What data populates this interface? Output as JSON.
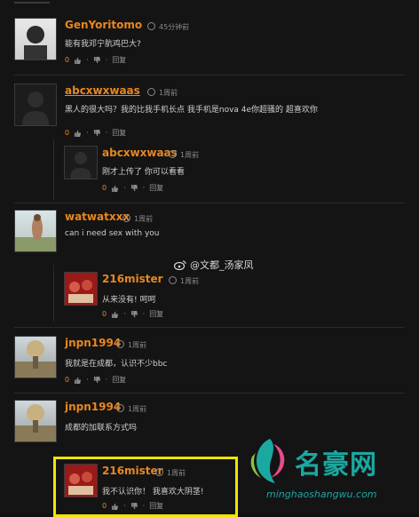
{
  "comments": [
    {
      "user": "GenYoritomo",
      "time": "45分钟前",
      "text": "能有我邓宁肮鸡巴大?",
      "likes": "0",
      "reply": "回复"
    },
    {
      "user": "abcxwxwaas",
      "time": "1周前",
      "text": "黑人的很大吗？我的比我手机长点 我手机是nova 4e你超骚的 超喜欢你",
      "likes": "0",
      "reply": "回复"
    },
    {
      "user": "abcxwxwaas",
      "time": "1周前",
      "text": "刚才上传了 你可以看看",
      "likes": "0",
      "reply": "回复"
    },
    {
      "user": "watwatxxx",
      "time": "1周前",
      "text": "can i need sex with you",
      "likes": "0",
      "reply": "回复"
    },
    {
      "user": "216mister",
      "time": "1周前",
      "text": "从来没有! 呵呵",
      "likes": "0",
      "reply": "回复"
    },
    {
      "user": "jnpn1994",
      "time": "1周前",
      "text": "我就是在成都，认识不少bbc",
      "likes": "0",
      "reply": "回复"
    },
    {
      "user": "jnpn1994",
      "time": "1周前",
      "text": "成都的加联系方式吗",
      "likes": "0",
      "reply": "回复"
    },
    {
      "user": "216mister",
      "time": "1周前",
      "text": "我不认识你！ 我喜欢大阴茎!",
      "likes": "0",
      "reply": "回复"
    }
  ],
  "watermark": {
    "text": "@文都_汤家凤"
  },
  "logo": {
    "title": "名豪网",
    "url": "minghaoshangwu.com"
  },
  "colors": {
    "username": "#e8871f",
    "background": "#141414",
    "highlight": "#f2e600",
    "logo": "#1aa9a0"
  },
  "icons": [
    "clock-icon",
    "thumbs-up-icon",
    "thumbs-down-icon",
    "weibo-icon"
  ]
}
